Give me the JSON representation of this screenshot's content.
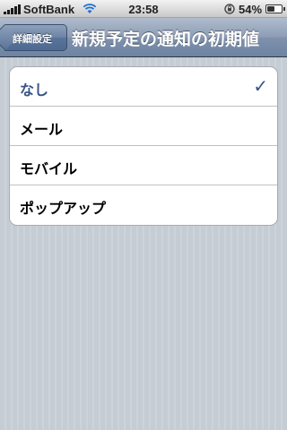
{
  "status_bar": {
    "carrier": "SoftBank",
    "time": "23:58",
    "battery_percent": "54%",
    "battery_level": 0.54
  },
  "nav_bar": {
    "back_label": "詳細設定",
    "title": "新規予定の通知の初期値"
  },
  "options": {
    "items": [
      {
        "label": "なし",
        "selected": true
      },
      {
        "label": "メール",
        "selected": false
      },
      {
        "label": "モバイル",
        "selected": false
      },
      {
        "label": "ポップアップ",
        "selected": false
      }
    ]
  },
  "icons": {
    "checkmark": "checkmark-icon",
    "wifi": "wifi-icon",
    "lock": "rotation-lock-icon",
    "signal": "signal-strength-icon",
    "battery": "battery-icon"
  },
  "colors": {
    "selected_text": "#385487",
    "nav_bar": "#6d84a2"
  }
}
